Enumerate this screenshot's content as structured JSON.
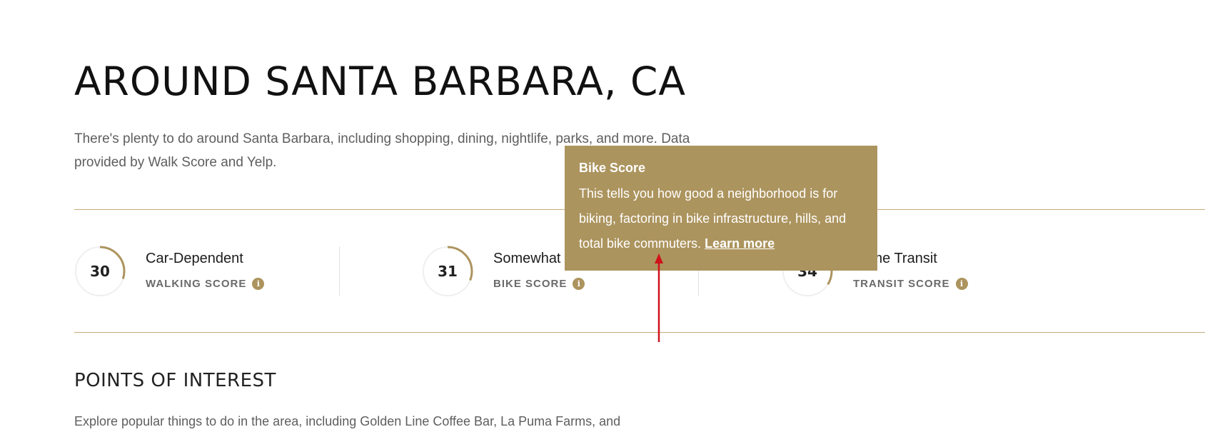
{
  "page": {
    "title": "AROUND SANTA BARBARA, CA",
    "intro": "There's plenty to do around Santa Barbara, including shopping, dining, nightlife, parks, and more. Data provided by Walk Score and Yelp."
  },
  "scores": [
    {
      "value": "30",
      "name": "Car-Dependent",
      "label": "WALKING SCORE",
      "percent": 30
    },
    {
      "value": "31",
      "name": "Somewhat Bikeable",
      "label": "BIKE SCORE",
      "percent": 31
    },
    {
      "value": "34",
      "name": "Some Transit",
      "label": "TRANSIT SCORE",
      "percent": 34
    }
  ],
  "points_of_interest": {
    "title": "POINTS OF INTEREST",
    "description": "Explore popular things to do in the area, including Golden Line Coffee Bar, La Puma Farms, and"
  },
  "tooltip": {
    "title": "Bike Score",
    "body": "This tells you how good a neighborhood is for biking, factoring in bike infrastructure, hills, and total bike commuters.",
    "link": "Learn more"
  },
  "icons": {
    "info": "info-icon",
    "annotation": "red-arrow-icon"
  },
  "colors": {
    "accent": "#ac945e",
    "rule": "#c8ab7a",
    "annotation_arrow": "#d0121b"
  }
}
